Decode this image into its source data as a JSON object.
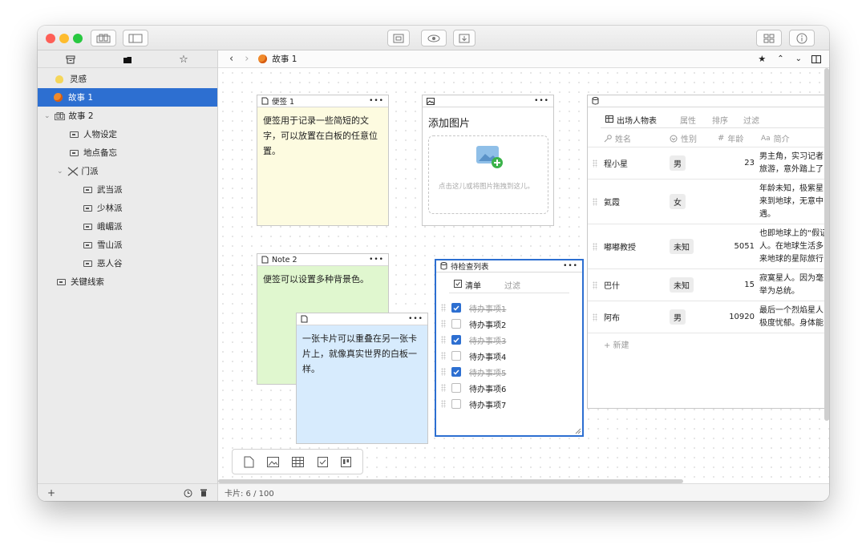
{
  "colors": {
    "accent": "#2d6fd1",
    "note_yellow": "#fdfbe0",
    "note_green": "#e0f7cf",
    "note_blue": "#d7ebfd",
    "traffic_red": "#fe5f57",
    "traffic_yellow": "#febc2e",
    "traffic_green": "#28c840"
  },
  "sidebar": {
    "tab_icons": [
      "archive-icon",
      "folder-icon",
      "star-icon"
    ],
    "items": [
      {
        "label": "灵感",
        "icon": "lightbulb-icon"
      },
      {
        "label": "故事 1",
        "icon": "peach-icon"
      },
      {
        "label": "故事 2",
        "icon": "board-icon"
      },
      {
        "label": "人物设定",
        "icon": "card-icon"
      },
      {
        "label": "地点备忘",
        "icon": "card-icon"
      },
      {
        "label": "门派",
        "icon": "crossed-swords-icon"
      },
      {
        "label": "武当派",
        "icon": "card-icon"
      },
      {
        "label": "少林派",
        "icon": "card-icon"
      },
      {
        "label": "峨嵋派",
        "icon": "card-icon"
      },
      {
        "label": "雪山派",
        "icon": "card-icon"
      },
      {
        "label": "恶人谷",
        "icon": "card-icon"
      },
      {
        "label": "关键线索",
        "icon": "card-icon"
      }
    ],
    "footer": {
      "add": "+",
      "history_icon": "clock-icon",
      "trash_icon": "trash-icon"
    }
  },
  "nav": {
    "back": "‹",
    "forward": "›",
    "title": "故事 1",
    "star": "★",
    "up": "⌃",
    "down": "⌄"
  },
  "cards": {
    "note1": {
      "title": "便签 1",
      "body": "便签用于记录一些简短的文字，可以放置在白板的任意位置。",
      "more": "•••"
    },
    "image": {
      "title": "添加图片",
      "hint": "点击这儿或将图片拖拽到这儿。",
      "more": "•••"
    },
    "note2": {
      "title": "Note 2",
      "body": "便签可以设置多种背景色。",
      "more": "•••"
    },
    "note3": {
      "title": "",
      "body": "一张卡片可以重叠在另一张卡片上，就像真实世界的白板一样。",
      "more": "•••"
    },
    "checklist": {
      "title": "待检查列表",
      "tabs": {
        "list": "清单",
        "filter": "过滤"
      },
      "items": [
        {
          "label": "待办事项1",
          "checked": true
        },
        {
          "label": "待办事项2",
          "checked": false
        },
        {
          "label": "待办事项3",
          "checked": true
        },
        {
          "label": "待办事项4",
          "checked": false
        },
        {
          "label": "待办事项5",
          "checked": true
        },
        {
          "label": "待办事项6",
          "checked": false
        },
        {
          "label": "待办事项7",
          "checked": false
        }
      ],
      "more": "•••"
    },
    "table": {
      "view_name": "出场人物表",
      "tabs": [
        "属性",
        "排序",
        "过滤"
      ],
      "columns": [
        "姓名",
        "性别",
        "年龄",
        "简介"
      ],
      "column_icons": [
        "key-icon",
        "select-icon",
        "number-icon",
        "text-icon"
      ],
      "rows": [
        {
          "name": "程小星",
          "gender": "男",
          "age": "23",
          "intro": "男主角，实习记者\n旅游，意外踏上了"
        },
        {
          "name": "氦霞",
          "gender": "女",
          "age": "",
          "intro": "年龄未知，极紫星\n来到地球，无意中\n遇。"
        },
        {
          "name": "嘟嘟教授",
          "gender": "未知",
          "age": "5051",
          "intro": "也即地球上的“假证\n人。在地球生活多\n来地球的星际旅行"
        },
        {
          "name": "巴什",
          "gender": "未知",
          "age": "15",
          "intro": "寂寞星人。因为毫\n举为总统。"
        },
        {
          "name": "阿布",
          "gender": "男",
          "age": "10920",
          "intro": "最后一个烈焰星人\n极度忧郁。身体能"
        }
      ],
      "new_row": "+ 新建"
    }
  },
  "status": {
    "cards": "卡片: 6 / 100"
  },
  "float_toolbar": [
    "note-icon",
    "image-icon",
    "table-icon",
    "checklist-icon",
    "kanban-icon"
  ]
}
